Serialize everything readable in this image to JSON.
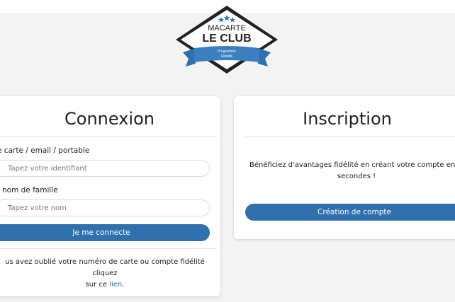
{
  "logo": {
    "line1": "MACARTE",
    "line2": "LE CLUB",
    "ribbon_line1": "Programme",
    "ribbon_line2": "Fidélité",
    "colors": {
      "dark": "#222222",
      "blue": "#2f70ad"
    }
  },
  "login": {
    "title": "Connexion",
    "id_label": "e carte / email / portable",
    "id_placeholder": "Tapez votre identifiant",
    "name_label": "nom de famille",
    "name_placeholder": "Tapez votre nom",
    "submit_label": "Je me connecte",
    "forgot_text_1": "us avez oublié votre numéro de carte ou compte fidélité cliquez",
    "forgot_text_2": "sur ce",
    "forgot_link": "lien",
    "forgot_end": "."
  },
  "signup": {
    "title": "Inscription",
    "text_1": "Bénéficiez d'avantages fidélité en créant votre compte en quelq",
    "text_2": "secondes !",
    "button_label": "Création de compte"
  },
  "colors": {
    "accent": "#2f70ad",
    "background": "#f3f3f3",
    "card": "#ffffff"
  }
}
